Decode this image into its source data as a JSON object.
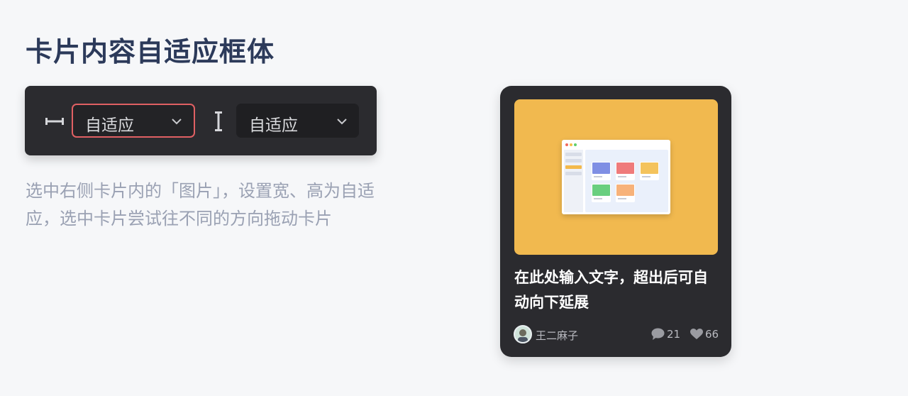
{
  "page": {
    "title": "卡片内容自适应框体",
    "instruction": "选中右侧卡片内的「图片」，设置宽、高为自适应，选中卡片尝试往不同的方向拖动卡片"
  },
  "toolbar": {
    "width_select": {
      "icon": "width-icon",
      "value": "自适应"
    },
    "height_select": {
      "icon": "height-icon",
      "value": "自适应"
    }
  },
  "card": {
    "title": "在此处输入文字，超出后可自动向下延展",
    "author": "王二麻子",
    "comment_count": "21",
    "like_count": "66"
  },
  "colors": {
    "background": "#f6f7f9",
    "panel": "#2b2b2f",
    "select_active_border": "#e06063",
    "card_image_bg": "#f1b94f",
    "title_text": "#2c3a5a",
    "muted_text": "#9aa1b3"
  }
}
